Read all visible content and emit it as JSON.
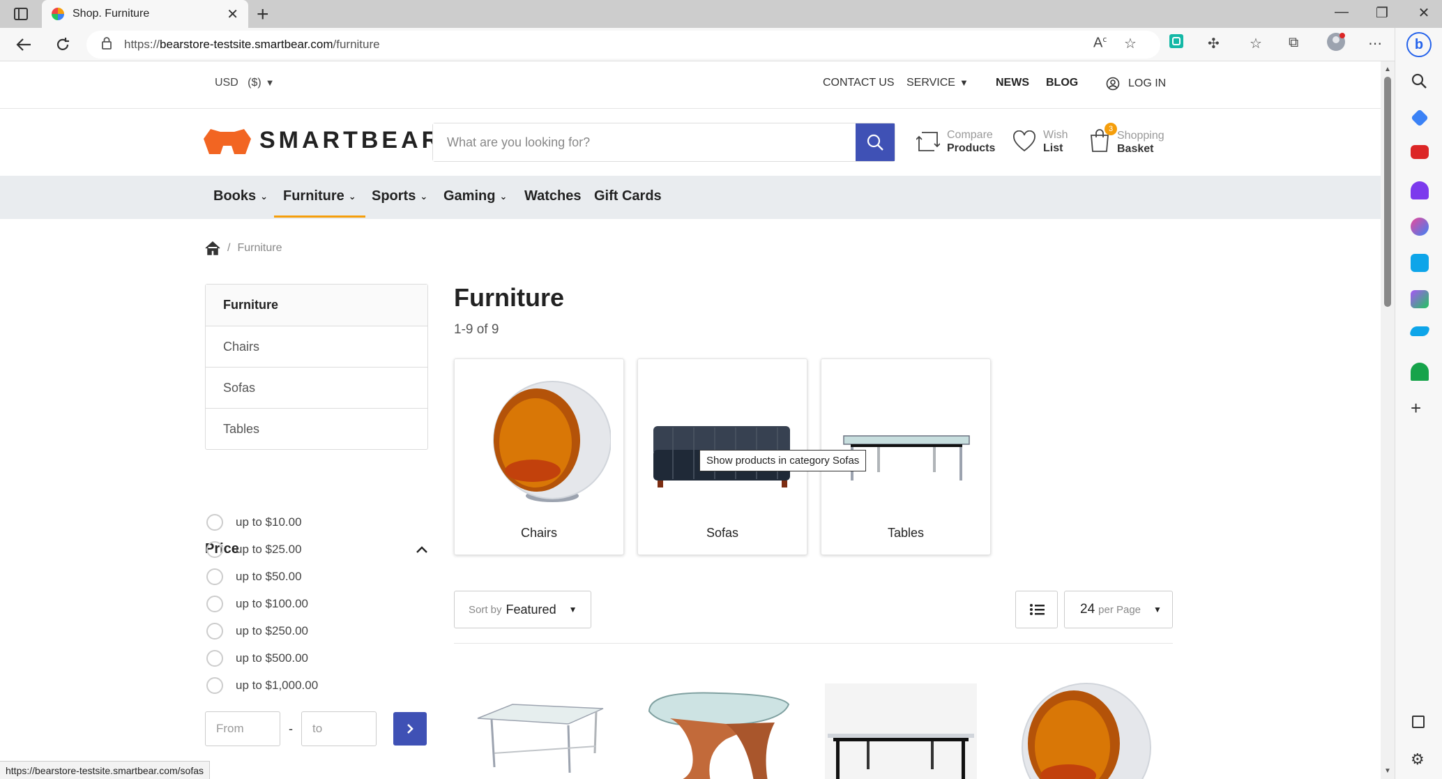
{
  "browser": {
    "tab_title": "Shop. Furniture",
    "url_prefix": "https://",
    "url_host": "bearstore-testsite.smartbear.com",
    "url_path": "/furniture",
    "status_url": "https://bearstore-testsite.smartbear.com/sofas"
  },
  "topbar": {
    "currency": "USD   ($)",
    "contact": "CONTACT US",
    "service": "SERVICE",
    "news": "NEWS",
    "blog": "BLOG",
    "login": "LOG IN"
  },
  "header": {
    "logo_text": "SMARTBEAR",
    "search_placeholder": "What are you looking for?",
    "compare_top": "Compare",
    "compare_bottom": "Products",
    "wish_top": "Wish",
    "wish_bottom": "List",
    "basket_top": "Shopping",
    "basket_bottom": "Basket",
    "basket_count": "3"
  },
  "catnav": {
    "items": [
      "Books",
      "Furniture",
      "Sports",
      "Gaming",
      "Watches",
      "Gift Cards"
    ]
  },
  "breadcrumb": {
    "sep": "/",
    "current": "Furniture"
  },
  "sidebar": {
    "categories": [
      "Furniture",
      "Chairs",
      "Sofas",
      "Tables"
    ],
    "price_title": "Price",
    "price_options": [
      "up to $10.00",
      "up to $25.00",
      "up to $50.00",
      "up to $100.00",
      "up to $250.00",
      "up to $500.00",
      "up to $1,000.00"
    ],
    "range_from": "From",
    "range_to": "to",
    "range_dash": "-"
  },
  "main": {
    "title": "Furniture",
    "count": "1-9 of 9",
    "category_cards": [
      "Chairs",
      "Sofas",
      "Tables"
    ],
    "tooltip": "Show products in category Sofas",
    "sort_prefix": "Sort by",
    "sort_value": "Featured",
    "per_page_value": "24",
    "per_page_suffix": "per Page"
  },
  "colors": {
    "brand_orange": "#f59e0b",
    "accent_blue": "#3f51b5"
  }
}
